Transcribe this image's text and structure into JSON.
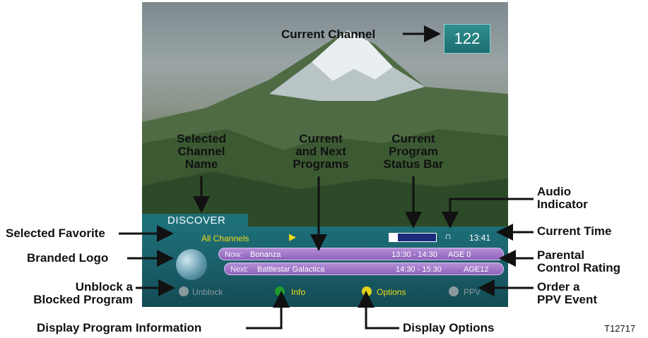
{
  "tv": {
    "channel_number": "122",
    "channel_name": "DISCOVER",
    "favorite": "All Channels",
    "time": "13:41",
    "now_label": "Now:",
    "now_program": "Bonanza",
    "now_time": "13:30 - 14:30",
    "now_rating": "AGE 0",
    "next_label": "Next:",
    "next_program": "Battlestar Galactica",
    "next_time": "14:30 - 15:30",
    "next_rating": "AGE12",
    "unblock_label": "Unblock",
    "info_label": "Info",
    "options_label": "Options",
    "ppv_label": "PPV",
    "status_bar_progress": 0.18,
    "colors": {
      "banner": "#1d6f78",
      "program_bar": "#9b72c6",
      "info_button": "#1f9a2b",
      "options_button": "#e0d21a",
      "disabled_button": "#8a9a9c"
    }
  },
  "callouts": {
    "current_channel": "Current Channel",
    "selected_channel_name": [
      "Selected",
      "Channel",
      "Name"
    ],
    "current_next_programs": [
      "Current",
      "and Next",
      "Programs"
    ],
    "program_status_bar": [
      "Current",
      "Program",
      "Status Bar"
    ],
    "audio_indicator": [
      "Audio",
      "Indicator"
    ],
    "selected_favorite": "Selected Favorite",
    "current_time": "Current Time",
    "branded_logo": "Branded Logo",
    "parental_control": [
      "Parental",
      "Control Rating"
    ],
    "unblock": [
      "Unblock a",
      "Blocked Program"
    ],
    "order_ppv": [
      "Order a",
      "PPV Event"
    ],
    "display_program_info": "Display Program Information",
    "display_options": "Display Options",
    "figure_id": "T12717"
  }
}
